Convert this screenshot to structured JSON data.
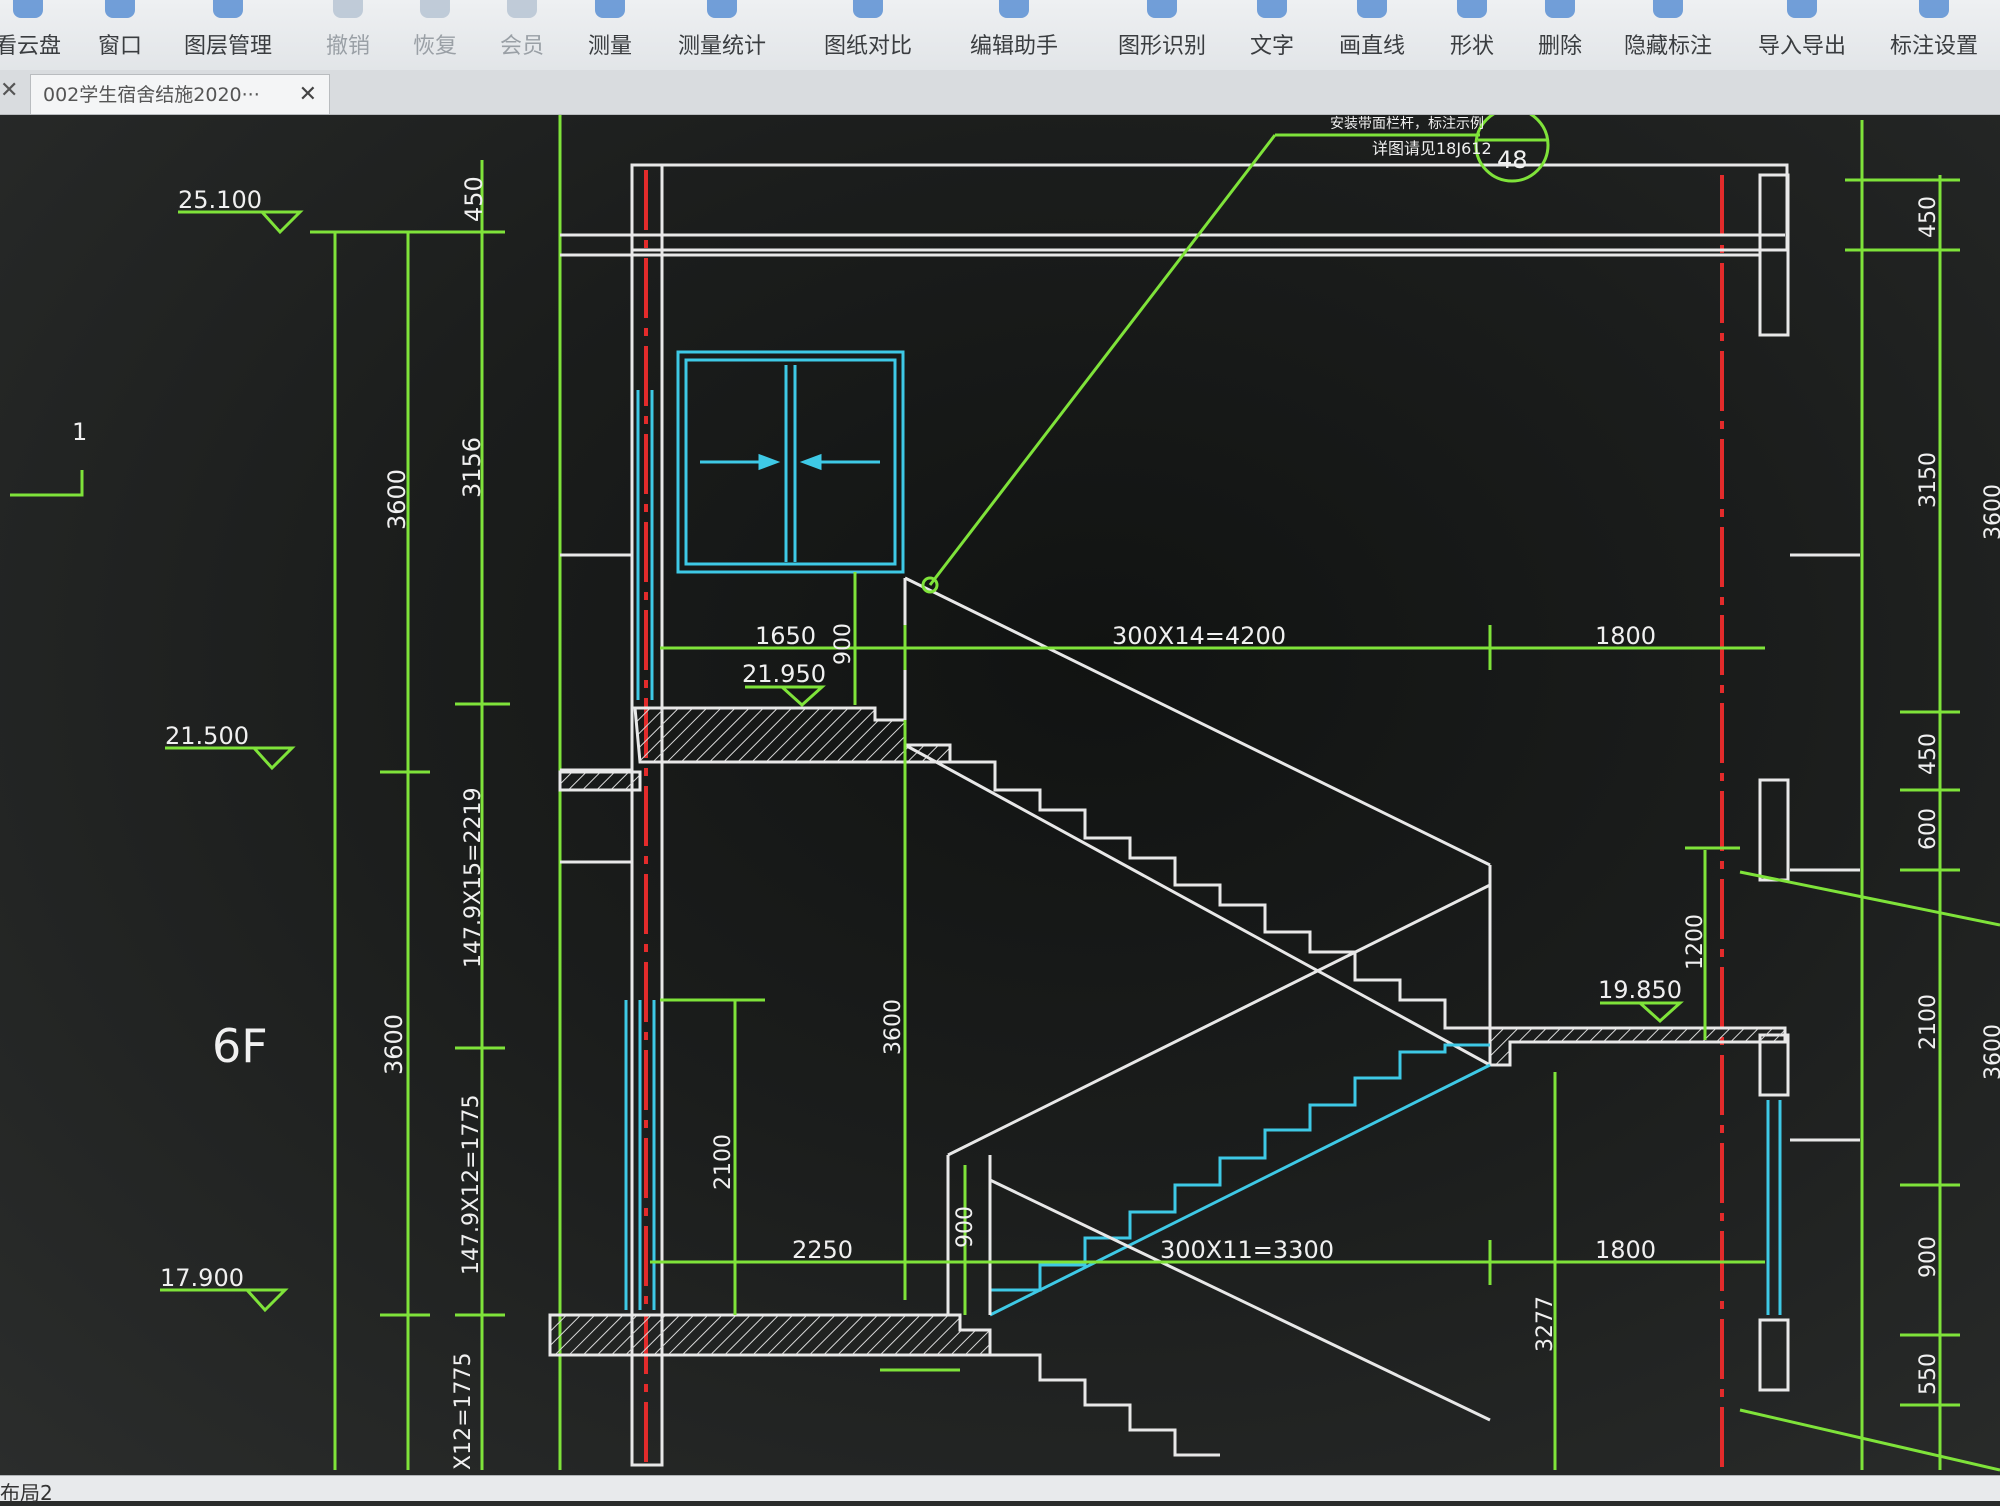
{
  "toolbar": {
    "items": [
      {
        "label": "看云盘"
      },
      {
        "label": "窗口"
      },
      {
        "label": "图层管理"
      },
      {
        "label": "撤销"
      },
      {
        "label": "恢复"
      },
      {
        "label": "会员"
      },
      {
        "label": "测量"
      },
      {
        "label": "测量统计"
      },
      {
        "label": "图纸对比"
      },
      {
        "label": "编辑助手"
      },
      {
        "label": "图形识别"
      },
      {
        "label": "文字"
      },
      {
        "label": "画直线"
      },
      {
        "label": "形状"
      },
      {
        "label": "删除"
      },
      {
        "label": "隐藏标注"
      },
      {
        "label": "导入导出"
      },
      {
        "label": "标注设置"
      }
    ]
  },
  "tabs": {
    "active_label": "002学生宿舍结施2020···"
  },
  "status": {
    "layout_label": "布局2"
  },
  "drawing": {
    "colors": {
      "dimension": "#7fe33a",
      "structure": "#e8e8e8",
      "window": "#3ec9e6",
      "axis": "#e32b2b",
      "background": "#141615"
    },
    "elevations": [
      "25.100",
      "21.500",
      "17.900",
      "21.950",
      "19.850"
    ],
    "floor_label": "6F",
    "grid_label": "1",
    "leader_text": [
      "安装带面栏杆，标注示例",
      "详图请见18J612"
    ],
    "detail_ref": "48",
    "left_dims": [
      "450",
      "3600",
      "3156",
      "3600",
      "147.9X15=2219",
      "147.9X12=1775",
      "X12=1775"
    ],
    "right_dims": [
      "450",
      "3150",
      "3600",
      "450",
      "600",
      "1200",
      "2100",
      "3600",
      "900",
      "550"
    ],
    "stair_dims": {
      "upper_landing": "1650",
      "upper_run": "300X14=4200",
      "upper_right": "1800",
      "upper_rail": "900",
      "lower_landing": "2250",
      "lower_run": "300X11=3300",
      "lower_right": "1800",
      "lower_rail": "900",
      "door_height": "2100",
      "mid_height": "3600",
      "right_height": "3277"
    }
  }
}
